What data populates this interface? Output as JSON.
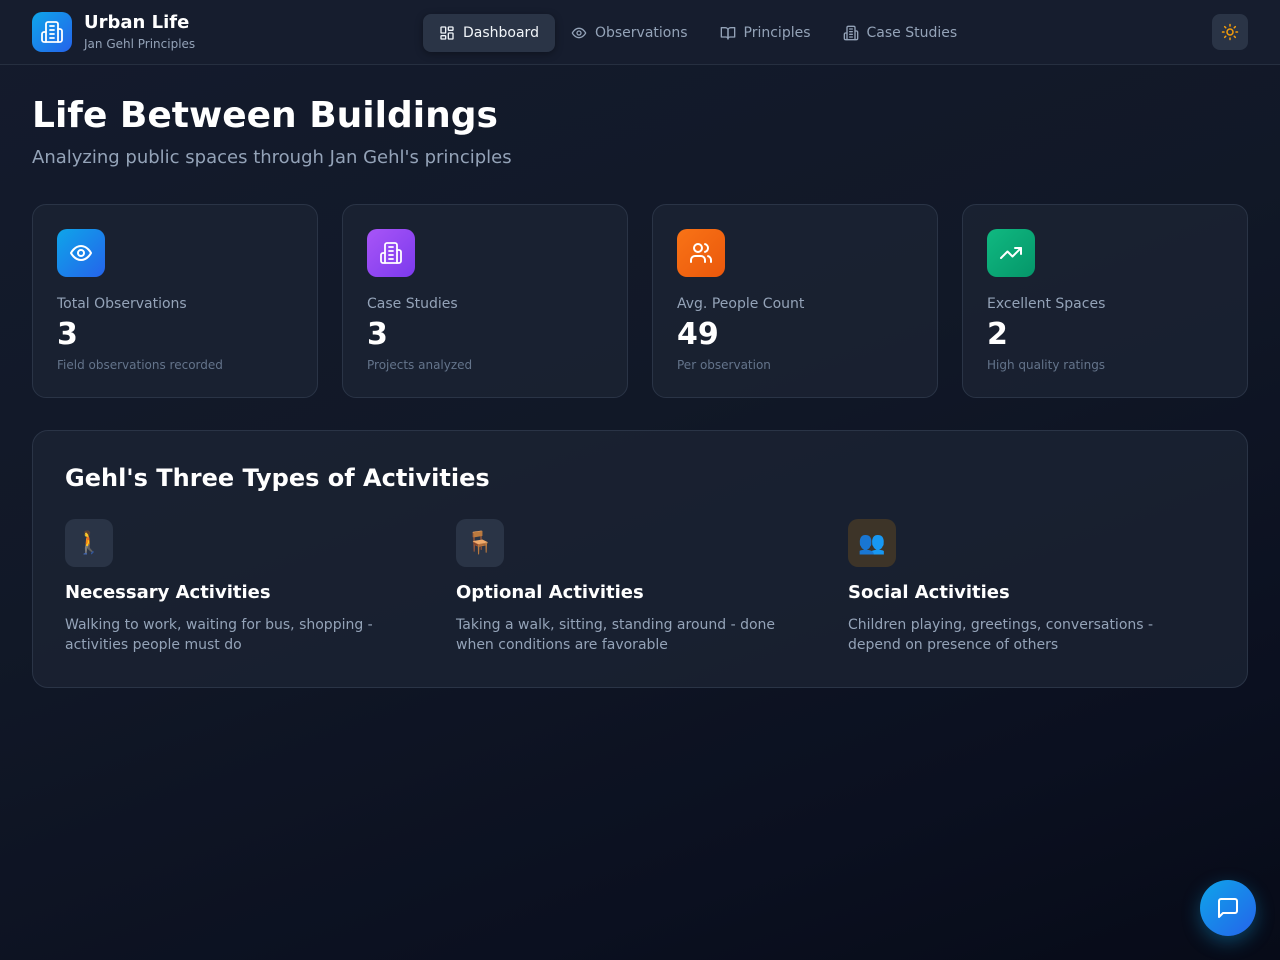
{
  "brand": {
    "title": "Urban Life",
    "subtitle": "Jan Gehl Principles",
    "icon": "building-icon"
  },
  "nav": {
    "items": [
      {
        "label": "Dashboard",
        "icon": "grid-icon",
        "active": true
      },
      {
        "label": "Observations",
        "icon": "eye-icon",
        "active": false
      },
      {
        "label": "Principles",
        "icon": "book-icon",
        "active": false
      },
      {
        "label": "Case Studies",
        "icon": "building-icon",
        "active": false
      }
    ],
    "theme_toggle": {
      "icon": "sun-icon",
      "color": "#f59e0b"
    }
  },
  "page": {
    "title": "Life Between Buildings",
    "subtitle": "Analyzing public spaces through Jan Gehl's principles"
  },
  "stats": [
    {
      "label": "Total Observations",
      "value": "3",
      "note": "Field observations recorded",
      "icon": "eye-icon",
      "color": "#0ea5e9"
    },
    {
      "label": "Case Studies",
      "value": "3",
      "note": "Projects analyzed",
      "icon": "building-icon",
      "color": "#8b5cf6"
    },
    {
      "label": "Avg. People Count",
      "value": "49",
      "note": "Per observation",
      "icon": "users-icon",
      "color": "#f97316"
    },
    {
      "label": "Excellent Spaces",
      "value": "2",
      "note": "High quality ratings",
      "icon": "trending-up-icon",
      "color": "#10b981"
    }
  ],
  "activities": {
    "heading": "Gehl's Three Types of Activities",
    "items": [
      {
        "title": "Necessary Activities",
        "description": "Walking to work, waiting for bus, shopping - activities people must do",
        "icon": "🚶",
        "icon_name": "walking-person-icon",
        "bg": "#2a3446"
      },
      {
        "title": "Optional Activities",
        "description": "Taking a walk, sitting, standing around - done when conditions are favorable",
        "icon": "🪑",
        "icon_name": "chair-icon",
        "bg": "#2a3446"
      },
      {
        "title": "Social Activities",
        "description": "Children playing, greetings, conversations - depend on presence of others",
        "icon": "👥",
        "icon_name": "people-icon",
        "bg": "#3d3428"
      }
    ]
  },
  "chat": {
    "icon": "chat-bubble-icon"
  }
}
